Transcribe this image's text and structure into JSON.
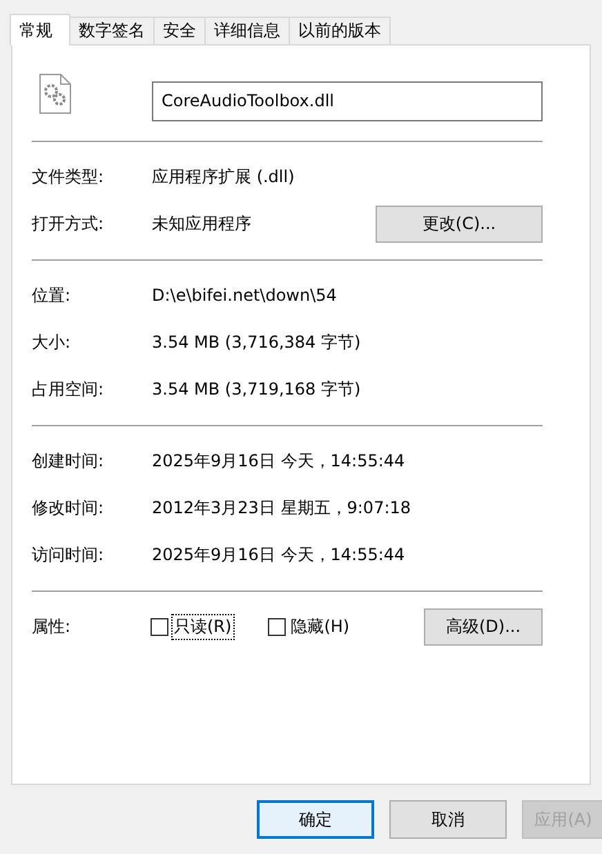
{
  "tabs": [
    {
      "label": "常规",
      "selected": true
    },
    {
      "label": "数字签名",
      "selected": false
    },
    {
      "label": "安全",
      "selected": false
    },
    {
      "label": "详细信息",
      "selected": false
    },
    {
      "label": "以前的版本",
      "selected": false
    }
  ],
  "file": {
    "name": "CoreAudioToolbox.dll"
  },
  "sections": [
    {
      "rows": [
        {
          "label": "文件类型:",
          "value": "应用程序扩展 (.dll)"
        },
        {
          "label": "打开方式:",
          "value": "未知应用程序",
          "button": "更改(C)..."
        }
      ]
    },
    {
      "rows": [
        {
          "label": "位置:",
          "value": "D:\\e\\bifei.net\\down\\54"
        },
        {
          "label": "大小:",
          "value": "3.54 MB (3,716,384 字节)"
        },
        {
          "label": "占用空间:",
          "value": "3.54 MB (3,719,168 字节)"
        }
      ]
    },
    {
      "rows": [
        {
          "label": "创建时间:",
          "value": "2025年9月16日 今天，14:55:44"
        },
        {
          "label": "修改时间:",
          "value": "2012年3月23日 星期五，9:07:18"
        },
        {
          "label": "访问时间:",
          "value": "2025年9月16日 今天，14:55:44"
        }
      ]
    }
  ],
  "attributes": {
    "label": "属性:",
    "checkboxes": [
      {
        "label": "只读(R)",
        "checked": false,
        "focused": true
      },
      {
        "label": "隐藏(H)",
        "checked": false,
        "focused": false
      }
    ],
    "button": "高级(D)..."
  },
  "buttons": [
    {
      "label": "确定",
      "default": true,
      "disabled": false
    },
    {
      "label": "取消",
      "default": false,
      "disabled": false
    },
    {
      "label": "应用(A)",
      "default": false,
      "disabled": true
    }
  ]
}
